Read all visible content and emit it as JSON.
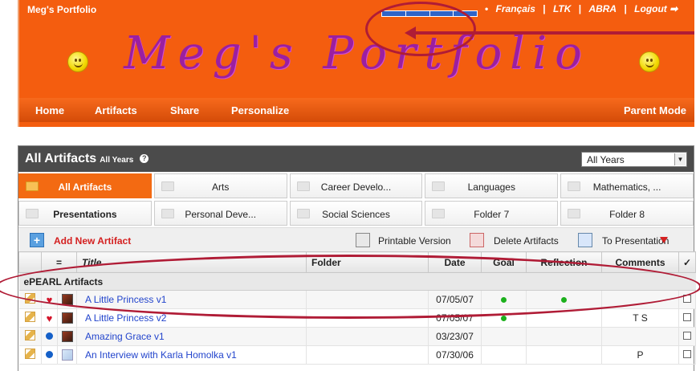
{
  "topbar": {
    "site_name": "Meg's Portfolio",
    "links": [
      "Français",
      "LTK",
      "ABRA",
      "Logout ➡"
    ]
  },
  "header": {
    "title": "Meg's Portfolio"
  },
  "nav": {
    "home": "Home",
    "artifacts": "Artifacts",
    "share": "Share",
    "personalize": "Personalize",
    "parent_mode": "Parent Mode"
  },
  "panel": {
    "title": "All Artifacts",
    "subtitle": "All Years",
    "year_select": "All Years"
  },
  "folders": [
    "All Artifacts",
    "Arts",
    "Career Develo...",
    "Languages",
    "Mathematics, ...",
    "Presentations",
    "Personal Deve...",
    "Social Sciences",
    "Folder 7",
    "Folder 8"
  ],
  "toolbar": {
    "add": "Add New Artifact",
    "printable": "Printable Version",
    "delete": "Delete Artifacts",
    "to_presentation": "To Presentation"
  },
  "table": {
    "headers": {
      "sort": "=",
      "title": "Title",
      "folder": "Folder",
      "date": "Date",
      "goal": "Goal",
      "reflection": "Reflection",
      "comments": "Comments",
      "select": "✓"
    },
    "group": "ePEARL Artifacts",
    "rows": [
      {
        "title": "A Little Princess v1",
        "folder": "",
        "date": "07/05/07",
        "comments": ""
      },
      {
        "title": "A Little Princess v2",
        "folder": "",
        "date": "07/05/07",
        "comments": "T S"
      },
      {
        "title": "Amazing Grace v1",
        "folder": "",
        "date": "03/23/07",
        "comments": ""
      },
      {
        "title": "An Interview with Karla Homolka v1",
        "folder": "",
        "date": "07/30/06",
        "comments": "P"
      }
    ]
  }
}
